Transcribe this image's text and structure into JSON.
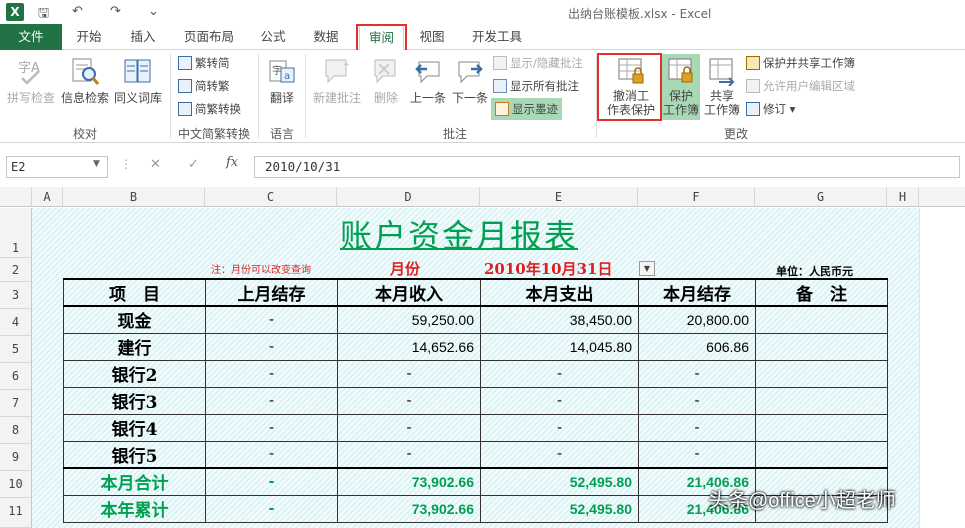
{
  "window": {
    "title": "出纳台账模板.xlsx - Excel",
    "logo": "X"
  },
  "quick_access": {
    "save": "🖫",
    "undo": "↶",
    "redo": "↷",
    "more": "⌄"
  },
  "tabs": [
    {
      "label": "文件"
    },
    {
      "label": "开始"
    },
    {
      "label": "插入"
    },
    {
      "label": "页面布局"
    },
    {
      "label": "公式"
    },
    {
      "label": "数据"
    },
    {
      "label": "审阅"
    },
    {
      "label": "视图"
    },
    {
      "label": "开发工具"
    }
  ],
  "ribbon": {
    "proofing": {
      "spell": "拼写检查",
      "research": "信息检索",
      "thesaurus": "同义词库",
      "label": "校对"
    },
    "chinese": {
      "t2s": "繁转简",
      "s2t": "简转繁",
      "convert": "简繁转换",
      "label": "中文简繁转换"
    },
    "language": {
      "translate": "翻译",
      "label": "语言"
    },
    "comments": {
      "new": "新建批注",
      "delete": "删除",
      "prev": "上一条",
      "next": "下一条",
      "show_hide": "显示/隐藏批注",
      "show_all": "显示所有批注",
      "show_ink": "显示墨迹",
      "label": "批注"
    },
    "changes": {
      "unprotect_sheet_1": "撤消工",
      "unprotect_sheet_2": "作表保护",
      "protect_wb_1": "保护",
      "protect_wb_2": "工作簿",
      "share_wb_1": "共享",
      "share_wb_2": "工作簿",
      "protect_share": "保护并共享工作簿",
      "allow_edit": "允许用户编辑区域",
      "track": "修订",
      "label": "更改"
    }
  },
  "formula_bar": {
    "name_box": "E2",
    "cancel": "✕",
    "enter": "✓",
    "fx": "fx",
    "value": "2010/10/31"
  },
  "columns": [
    "A",
    "B",
    "C",
    "D",
    "E",
    "F",
    "G",
    "H"
  ],
  "rows": [
    "1",
    "2",
    "3",
    "4",
    "5",
    "6",
    "7",
    "8",
    "9",
    "10",
    "11"
  ],
  "sheet": {
    "title": "账户资金月报表",
    "note": "注：月份可以改变查询",
    "month_label": "月份",
    "date": "2010年10月31日",
    "unit": "单位：人民币元",
    "headers": [
      "项　目",
      "上月结存",
      "本月收入",
      "本月支出",
      "本月结存",
      "备　注"
    ],
    "rows": [
      {
        "name": "现金",
        "prev": "-",
        "income": "59,250.00",
        "expense": "38,450.00",
        "balance": "20,800.00",
        "remark": ""
      },
      {
        "name": "建行",
        "prev": "-",
        "income": "14,652.66",
        "expense": "14,045.80",
        "balance": "606.86",
        "remark": ""
      },
      {
        "name": "银行2",
        "prev": "-",
        "income": "-",
        "expense": "-",
        "balance": "-",
        "remark": ""
      },
      {
        "name": "银行3",
        "prev": "-",
        "income": "-",
        "expense": "-",
        "balance": "-",
        "remark": ""
      },
      {
        "name": "银行4",
        "prev": "-",
        "income": "-",
        "expense": "-",
        "balance": "-",
        "remark": ""
      },
      {
        "name": "银行5",
        "prev": "-",
        "income": "-",
        "expense": "-",
        "balance": "-",
        "remark": ""
      }
    ],
    "totals": [
      {
        "name": "本月合计",
        "prev": "-",
        "income": "73,902.66",
        "expense": "52,495.80",
        "balance": "21,406.86",
        "remark": ""
      },
      {
        "name": "本年累计",
        "prev": "-",
        "income": "73,902.66",
        "expense": "52,495.80",
        "balance": "21,406.86",
        "remark": ""
      }
    ]
  },
  "watermark": "头条@office小超老师"
}
